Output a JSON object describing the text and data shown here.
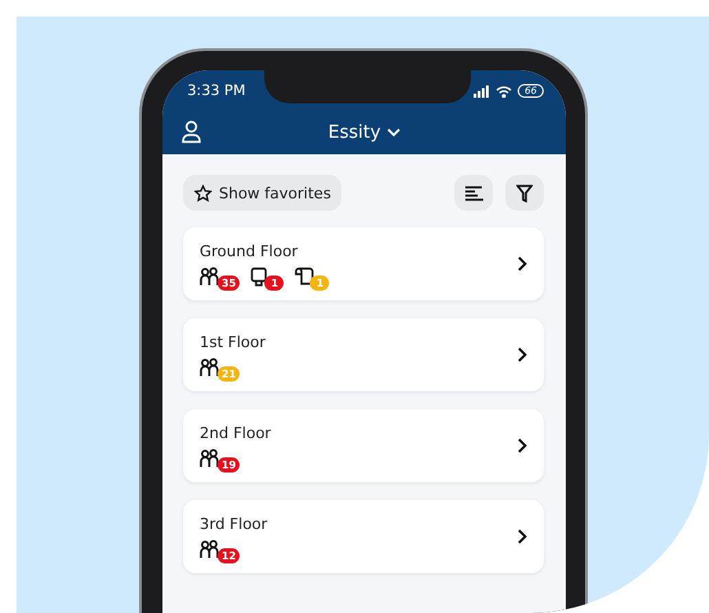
{
  "status_bar": {
    "time": "3:33 PM",
    "battery": "66"
  },
  "header": {
    "title": "Essity"
  },
  "toolbar": {
    "favorites_label": "Show favorites"
  },
  "floors": [
    {
      "name": "Ground Floor",
      "indicators": [
        {
          "kind": "people",
          "count": "35",
          "color": "#e8101c"
        },
        {
          "kind": "dispenser",
          "count": "1",
          "color": "#e8101c"
        },
        {
          "kind": "roll",
          "count": "1",
          "color": "#f5b50f"
        }
      ]
    },
    {
      "name": "1st Floor",
      "indicators": [
        {
          "kind": "people",
          "count": "21",
          "color": "#f5b50f"
        }
      ]
    },
    {
      "name": "2nd Floor",
      "indicators": [
        {
          "kind": "people",
          "count": "19",
          "color": "#e8101c"
        }
      ]
    },
    {
      "name": "3rd Floor",
      "indicators": [
        {
          "kind": "people",
          "count": "12",
          "color": "#e8101c"
        }
      ]
    }
  ]
}
